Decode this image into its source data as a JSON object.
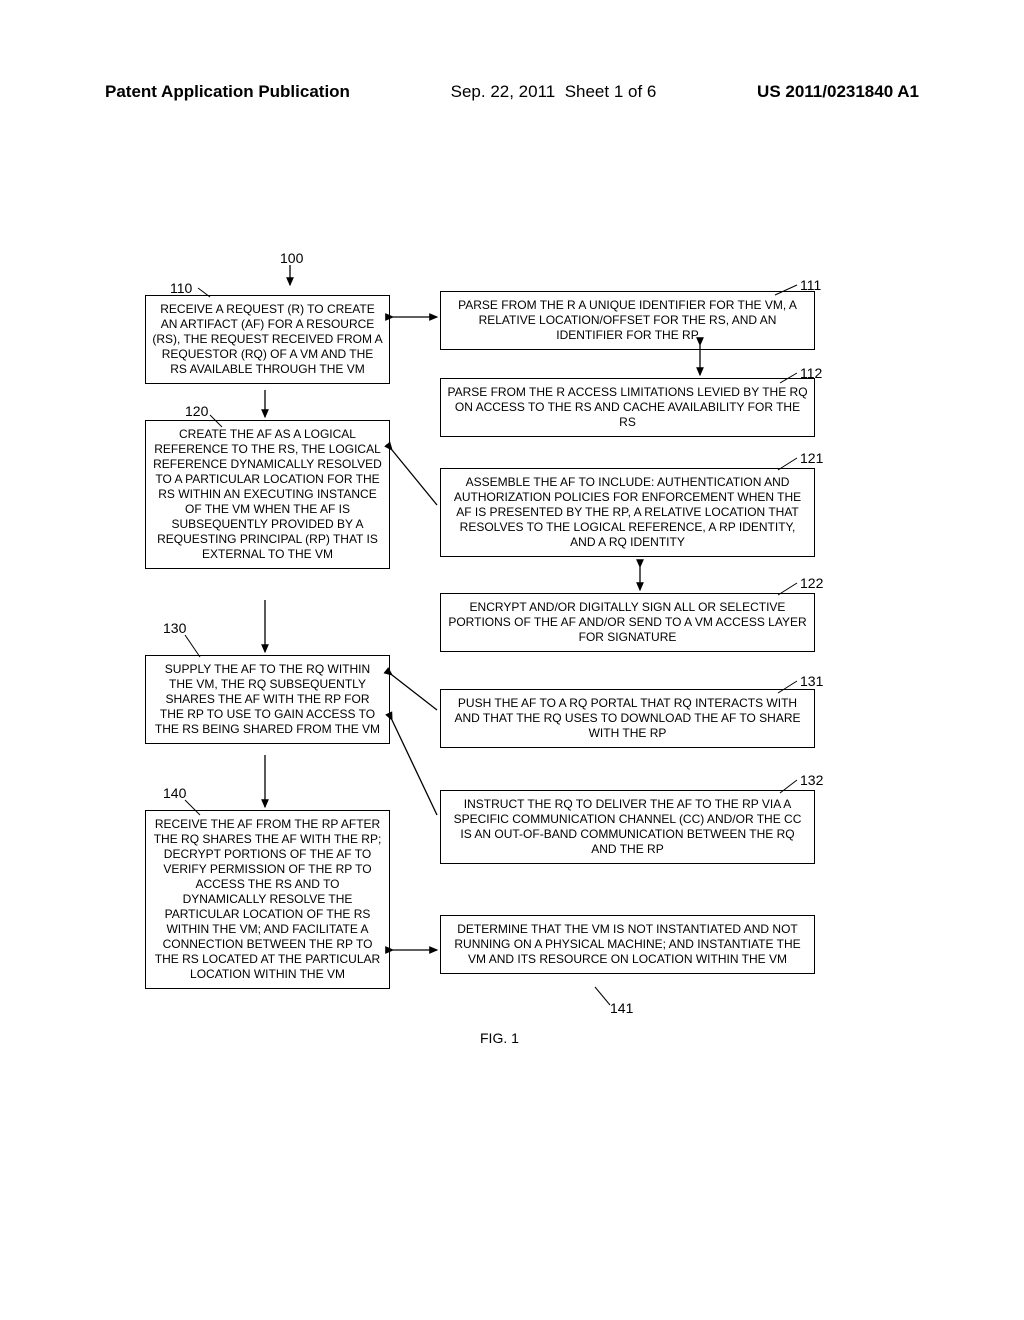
{
  "header": {
    "pub_type": "Patent Application Publication",
    "date": "Sep. 22, 2011",
    "sheet": "Sheet 1 of 6",
    "pub_no": "US 2011/0231840 A1"
  },
  "labels": {
    "n100": "100",
    "n110": "110",
    "n111": "111",
    "n112": "112",
    "n120": "120",
    "n121": "121",
    "n122": "122",
    "n130": "130",
    "n131": "131",
    "n132": "132",
    "n140": "140",
    "n141": "141"
  },
  "boxes": {
    "b110": "RECEIVE A REQUEST (R) TO CREATE AN ARTIFACT (AF) FOR A RESOURCE (RS), THE REQUEST RECEIVED FROM A REQUESTOR (RQ) OF A VM AND THE RS AVAILABLE THROUGH THE VM",
    "b111": "PARSE FROM THE R A UNIQUE IDENTIFIER FOR THE VM, A RELATIVE LOCATION/OFFSET FOR THE RS, AND AN IDENTIFIER FOR THE RP",
    "b112": "PARSE FROM THE R ACCESS LIMITATIONS LEVIED BY THE RQ ON ACCESS TO THE RS AND CACHE AVAILABILITY FOR THE RS",
    "b120": "CREATE THE AF AS A LOGICAL REFERENCE TO THE RS, THE LOGICAL REFERENCE DYNAMICALLY RESOLVED TO A PARTICULAR LOCATION FOR THE RS WITHIN AN EXECUTING INSTANCE OF THE VM WHEN THE AF IS SUBSEQUENTLY PROVIDED BY A REQUESTING PRINCIPAL (RP) THAT IS EXTERNAL TO THE VM",
    "b121": "ASSEMBLE THE AF TO INCLUDE: AUTHENTICATION AND AUTHORIZATION POLICIES FOR ENFORCEMENT WHEN THE AF IS PRESENTED BY THE RP, A RELATIVE LOCATION THAT RESOLVES TO THE LOGICAL REFERENCE, A RP IDENTITY, AND A RQ IDENTITY",
    "b122": "ENCRYPT AND/OR DIGITALLY SIGN ALL OR SELECTIVE PORTIONS OF THE AF AND/OR SEND TO A VM ACCESS LAYER FOR SIGNATURE",
    "b130": "SUPPLY THE AF TO THE RQ WITHIN THE VM, THE RQ SUBSEQUENTLY SHARES THE AF WITH THE RP FOR THE RP TO USE TO GAIN ACCESS TO THE RS BEING SHARED FROM THE VM",
    "b131": "PUSH THE AF TO A RQ PORTAL THAT RQ INTERACTS WITH AND THAT THE RQ USES TO DOWNLOAD THE AF TO SHARE WITH THE RP",
    "b132": "INSTRUCT THE RQ TO DELIVER THE AF TO THE RP VIA A SPECIFIC COMMUNICATION CHANNEL (CC) AND/OR THE CC IS AN OUT-OF-BAND COMMUNICATION BETWEEN THE RQ AND THE RP",
    "b140": "RECEIVE THE AF FROM THE RP AFTER THE RQ SHARES THE AF WITH THE RP; DECRYPT PORTIONS OF THE AF TO VERIFY PERMISSION OF THE RP TO ACCESS THE RS AND TO DYNAMICALLY RESOLVE THE PARTICULAR LOCATION OF THE RS WITHIN THE VM; AND FACILITATE A CONNECTION BETWEEN THE RP TO THE RS LOCATED AT THE PARTICULAR LOCATION WITHIN THE VM",
    "b141": "DETERMINE THAT THE VM IS NOT INSTANTIATED AND NOT RUNNING ON A PHYSICAL MACHINE; AND INSTANTIATE THE VM AND ITS RESOURCE ON LOCATION WITHIN THE VM"
  },
  "figure_caption": "FIG. 1"
}
